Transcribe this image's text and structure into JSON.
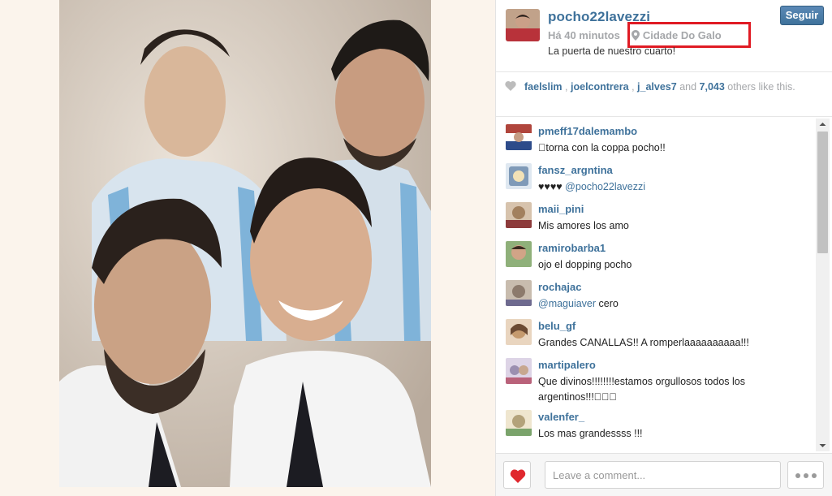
{
  "post": {
    "username": "pocho22lavezzi",
    "time": "Há 40 minutos",
    "location": "Cidade Do Galo",
    "caption": "La puerta de nuestro cuarto!",
    "follow_label": "Seguir",
    "icons": {
      "location": "map-pin-icon",
      "like": "heart-icon"
    }
  },
  "likes": {
    "users": [
      "faelslim",
      "joelcontrera",
      "j_alves7"
    ],
    "sep": ",",
    "and": "and",
    "count": "7,043",
    "suffix": "others like this."
  },
  "comments": [
    {
      "user": "pmeff17dalemambo",
      "text": "\u0000torna con la coppa pocho!!",
      "avatar_color": "#b0453c"
    },
    {
      "user": "fansz_argntina",
      "text": "♥♥♥♥",
      "mention": "@pocho22lavezzi",
      "avatar_color": "#7f9ab8"
    },
    {
      "user": "maii_pini",
      "text": "Mis amores los amo",
      "avatar_color": "#a2805e"
    },
    {
      "user": "ramirobarba1",
      "text": "ojo el dopping pocho",
      "avatar_color": "#6f8a58"
    },
    {
      "user": "rochajac",
      "mention": "@maguiaver",
      "text": " cero",
      "avatar_color": "#8c7a6c"
    },
    {
      "user": "belu_gf",
      "text": "Grandes CANALLAS!! A romperlaaaaaaaaaa!!!",
      "avatar_color": "#c59a6e"
    },
    {
      "user": "martipalero",
      "text": "Que divinos!!!!!!!!estamos orgullosos todos los argentinos!!!\u0000\u0000\u0000",
      "avatar_color": "#9b8fb0"
    },
    {
      "user": "valenfer_",
      "text": "Los mas grandessss !!!",
      "avatar_color": "#b3a27a"
    }
  ],
  "footer": {
    "comment_placeholder": "Leave a comment..."
  },
  "colors": {
    "link": "#3f729b",
    "muted": "#a5a7aa",
    "highlight_box": "#e01b24",
    "heart": "#e0282e"
  }
}
